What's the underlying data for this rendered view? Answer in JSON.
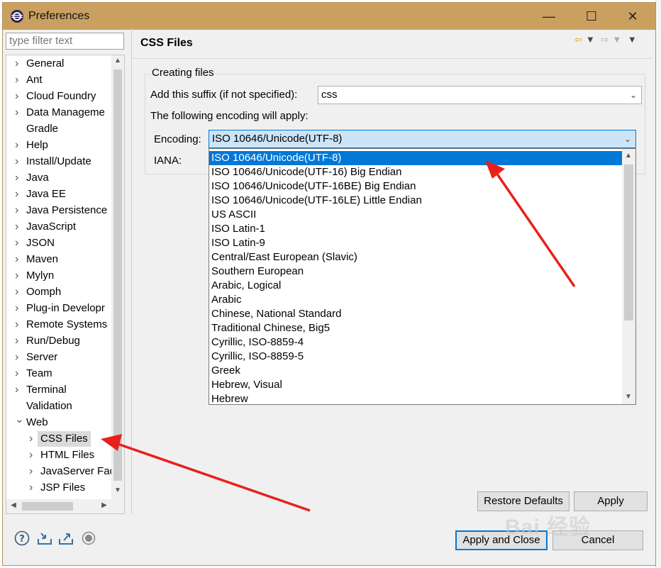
{
  "window": {
    "title": "Preferences"
  },
  "window_buttons": {
    "minimize": "—",
    "maximize": "☐",
    "close": "✕"
  },
  "filter": {
    "placeholder": "type filter text"
  },
  "tree": {
    "items": [
      {
        "label": "General",
        "expandable": true,
        "level": 0
      },
      {
        "label": "Ant",
        "expandable": true,
        "level": 0
      },
      {
        "label": "Cloud Foundry",
        "expandable": true,
        "level": 0
      },
      {
        "label": "Data Manageme",
        "expandable": true,
        "level": 0
      },
      {
        "label": "Gradle",
        "expandable": false,
        "level": 0
      },
      {
        "label": "Help",
        "expandable": true,
        "level": 0
      },
      {
        "label": "Install/Update",
        "expandable": true,
        "level": 0
      },
      {
        "label": "Java",
        "expandable": true,
        "level": 0
      },
      {
        "label": "Java EE",
        "expandable": true,
        "level": 0
      },
      {
        "label": "Java Persistence",
        "expandable": true,
        "level": 0
      },
      {
        "label": "JavaScript",
        "expandable": true,
        "level": 0
      },
      {
        "label": "JSON",
        "expandable": true,
        "level": 0
      },
      {
        "label": "Maven",
        "expandable": true,
        "level": 0
      },
      {
        "label": "Mylyn",
        "expandable": true,
        "level": 0
      },
      {
        "label": "Oomph",
        "expandable": true,
        "level": 0
      },
      {
        "label": "Plug-in Developr",
        "expandable": true,
        "level": 0
      },
      {
        "label": "Remote Systems",
        "expandable": true,
        "level": 0
      },
      {
        "label": "Run/Debug",
        "expandable": true,
        "level": 0
      },
      {
        "label": "Server",
        "expandable": true,
        "level": 0
      },
      {
        "label": "Team",
        "expandable": true,
        "level": 0
      },
      {
        "label": "Terminal",
        "expandable": true,
        "level": 0
      },
      {
        "label": "Validation",
        "expandable": false,
        "level": 0
      },
      {
        "label": "Web",
        "expandable": true,
        "expanded": true,
        "level": 0
      },
      {
        "label": "CSS Files",
        "expandable": true,
        "level": 1,
        "selected": true
      },
      {
        "label": "HTML Files",
        "expandable": true,
        "level": 1
      },
      {
        "label": "JavaServer Fac",
        "expandable": true,
        "level": 1
      },
      {
        "label": "JSP Files",
        "expandable": true,
        "level": 1
      }
    ]
  },
  "page": {
    "title": "CSS Files",
    "group_title": "Creating files",
    "suffix_label": "Add this suffix (if not specified):",
    "suffix_value": "css",
    "encoding_note": "The following encoding will apply:",
    "encoding_label": "Encoding:",
    "encoding_value": "ISO 10646/Unicode(UTF-8)",
    "iana_label": "IANA:"
  },
  "encoding_options": [
    "ISO 10646/Unicode(UTF-8)",
    "ISO 10646/Unicode(UTF-16) Big Endian",
    "ISO 10646/Unicode(UTF-16BE) Big Endian",
    "ISO 10646/Unicode(UTF-16LE) Little Endian",
    "US ASCII",
    "ISO Latin-1",
    "ISO Latin-9",
    "Central/East European (Slavic)",
    "Southern European",
    "Arabic, Logical",
    "Arabic",
    "Chinese, National Standard",
    "Traditional Chinese, Big5",
    "Cyrillic, ISO-8859-4",
    "Cyrillic, ISO-8859-5",
    "Greek",
    "Hebrew, Visual",
    "Hebrew"
  ],
  "buttons": {
    "restore_defaults": "Restore Defaults",
    "apply": "Apply",
    "apply_and_close": "Apply and Close",
    "cancel": "Cancel"
  },
  "watermark": "Bai 经验",
  "colors": {
    "titlebar": "#c9a060",
    "selection": "#0078d7",
    "arrow": "#e8201a"
  }
}
